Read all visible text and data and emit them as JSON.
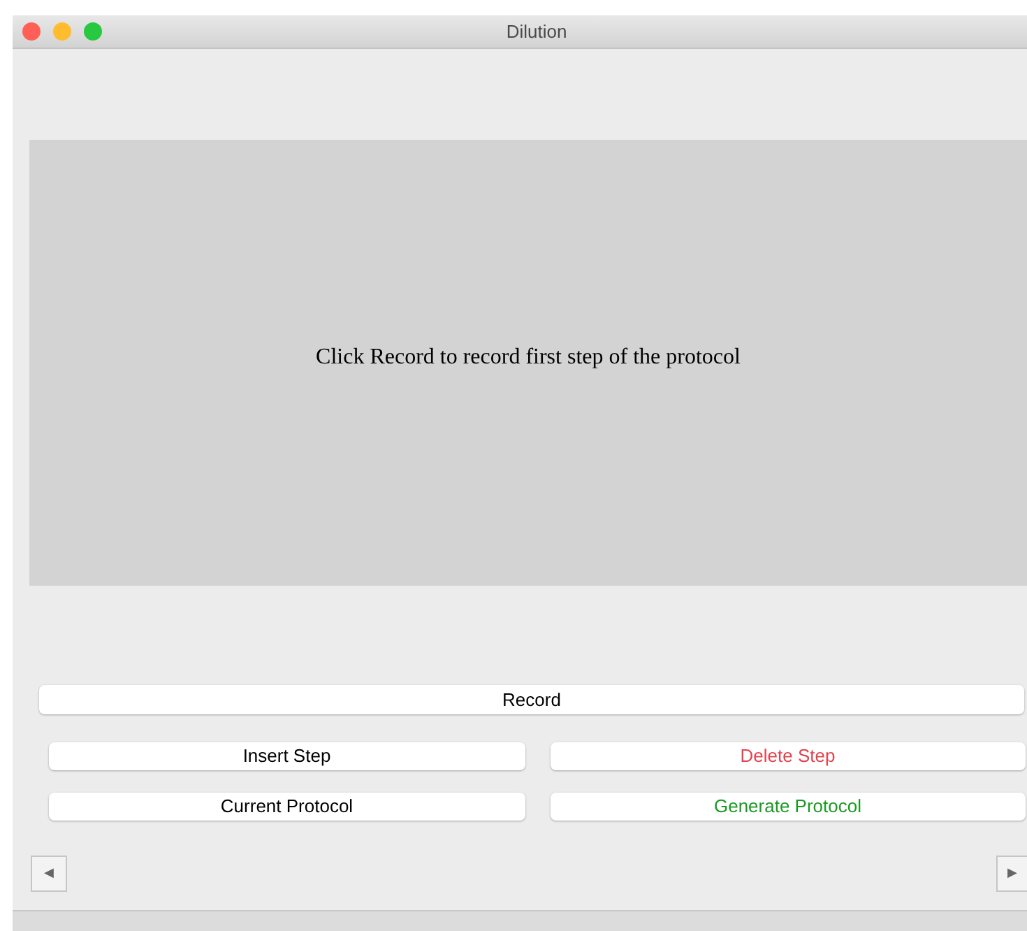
{
  "window": {
    "title": "Dilution"
  },
  "canvas": {
    "message": "Click Record to record first step of the protocol"
  },
  "record_button": {
    "label": "Record"
  },
  "actions": [
    {
      "label": "Insert Step",
      "kind": "default"
    },
    {
      "label": "Delete Step",
      "kind": "danger"
    },
    {
      "label": "Current Protocol",
      "kind": "default"
    },
    {
      "label": "Generate Protocol",
      "kind": "success"
    }
  ],
  "nav": {
    "previous": "◀",
    "next": "▶"
  }
}
